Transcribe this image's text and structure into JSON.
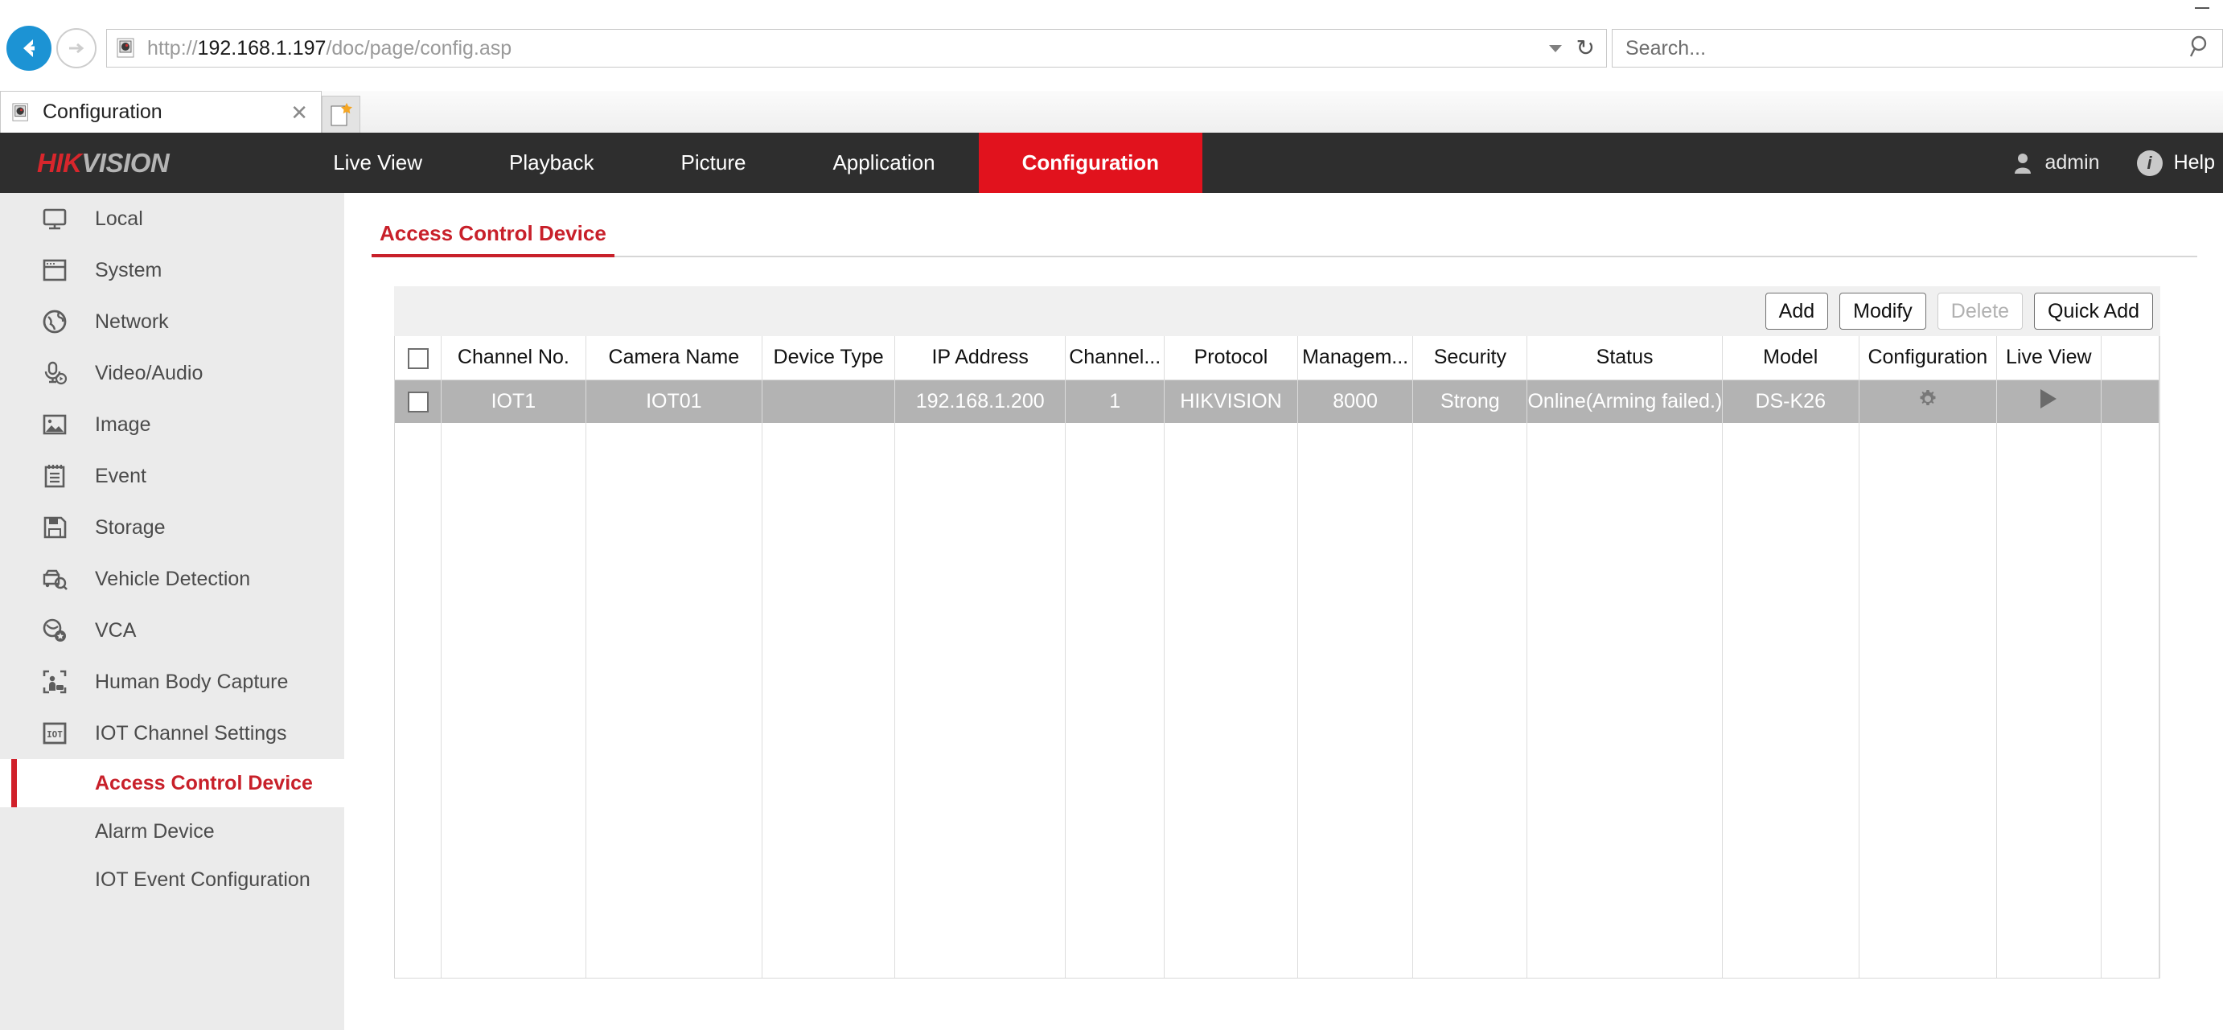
{
  "browser": {
    "window_controls": {
      "minimize": "minimize-button"
    },
    "back_label": "Back",
    "forward_label": "Forward",
    "url_scheme": "http://",
    "url_host": "192.168.1.197",
    "url_path": "/doc/page/config.asp",
    "url_full": "http://192.168.1.197/doc/page/config.asp",
    "search_placeholder": "Search...",
    "tab_title": "Configuration",
    "tab_close": "✕",
    "new_tab_label": "New tab"
  },
  "header": {
    "logo_red": "HIK",
    "logo_gray": "VISION",
    "nav": [
      {
        "label": "Live View",
        "active": false
      },
      {
        "label": "Playback",
        "active": false
      },
      {
        "label": "Picture",
        "active": false
      },
      {
        "label": "Application",
        "active": false
      },
      {
        "label": "Configuration",
        "active": true
      }
    ],
    "user": "admin",
    "help": "Help",
    "accent_red": "#e1121d",
    "bar_dark": "#2e2e2e"
  },
  "sidebar": {
    "items": [
      {
        "label": "Local",
        "icon": "monitor-icon"
      },
      {
        "label": "System",
        "icon": "window-icon"
      },
      {
        "label": "Network",
        "icon": "globe-icon"
      },
      {
        "label": "Video/Audio",
        "icon": "microphone-icon"
      },
      {
        "label": "Image",
        "icon": "picture-icon"
      },
      {
        "label": "Event",
        "icon": "notepad-icon"
      },
      {
        "label": "Storage",
        "icon": "floppy-disk-icon"
      },
      {
        "label": "Vehicle Detection",
        "icon": "vehicle-search-icon"
      },
      {
        "label": "VCA",
        "icon": "vca-icon"
      },
      {
        "label": "Human Body Capture",
        "icon": "human-capture-icon"
      },
      {
        "label": "IOT Channel Settings",
        "icon": "iot-icon"
      }
    ],
    "sub_items": [
      {
        "label": "Access Control Device",
        "active": true
      },
      {
        "label": "Alarm Device",
        "active": false
      },
      {
        "label": "IOT Event Configuration",
        "active": false
      }
    ]
  },
  "main": {
    "tab_label": "Access Control Device",
    "toolbar": {
      "add": "Add",
      "modify": "Modify",
      "delete": "Delete",
      "quick_add": "Quick Add",
      "delete_disabled": true
    },
    "table": {
      "columns": [
        "Channel No.",
        "Camera Name",
        "Device Type",
        "IP Address",
        "Channel...",
        "Protocol",
        "Managem...",
        "Security",
        "Status",
        "Model",
        "Configuration",
        "Live View"
      ],
      "rows": [
        {
          "selected": false,
          "channel_no": "IOT1",
          "camera_name": "IOT01",
          "device_type": "",
          "ip_address": "192.168.1.200",
          "channel": "1",
          "protocol": "HIKVISION",
          "management_port": "8000",
          "security": "Strong",
          "status": "Online(Arming failed.)",
          "model": "DS-K26",
          "configuration_icon": "gear-icon",
          "live_view_icon": "play-icon"
        }
      ],
      "row_highlight_color": "#b3b3b3"
    }
  }
}
